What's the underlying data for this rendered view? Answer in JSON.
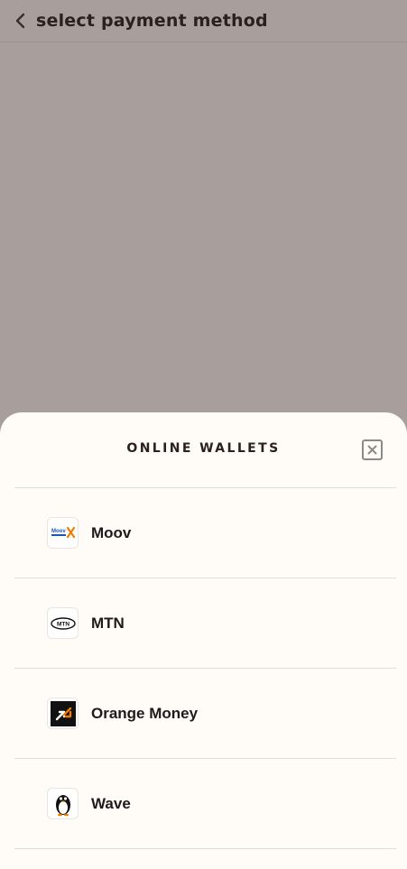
{
  "header": {
    "back_icon": "chevron-left-icon",
    "title": "select payment method"
  },
  "sheet": {
    "title": "ONLINE WALLETS",
    "close_icon": "close-icon",
    "wallets": [
      {
        "label": "Moov",
        "icon": "moov-logo-icon"
      },
      {
        "label": "MTN",
        "icon": "mtn-logo-icon"
      },
      {
        "label": "Orange Money",
        "icon": "orange-money-logo-icon"
      },
      {
        "label": "Wave",
        "icon": "wave-penguin-logo-icon"
      }
    ]
  },
  "colors": {
    "overlay": "#a89f9d",
    "sheet_bg": "#fffbf7",
    "text_dark": "#2c201f",
    "orange": "#f07c00",
    "moov_blue": "#1a56b0"
  }
}
